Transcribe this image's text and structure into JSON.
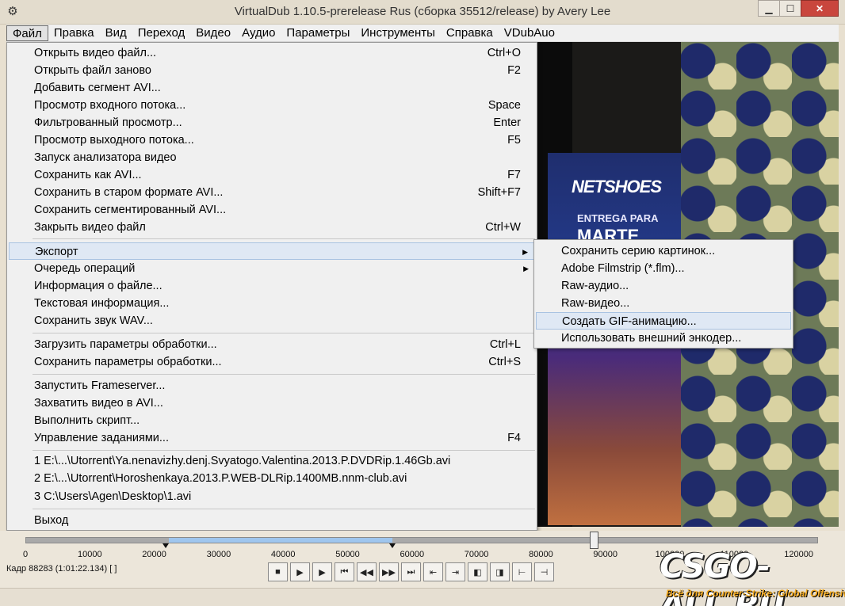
{
  "window": {
    "title": "VirtualDub 1.10.5-prerelease Rus (сборка 35512/release) by Avery Lee",
    "icon": "virtualdub-app-icon"
  },
  "menubar": [
    "Файл",
    "Правка",
    "Вид",
    "Переход",
    "Видео",
    "Аудио",
    "Параметры",
    "Инструменты",
    "Справка",
    "VDubAuo"
  ],
  "file_menu": {
    "items": [
      {
        "label": "Открыть видео файл...",
        "shortcut": "Ctrl+O"
      },
      {
        "label": "Открыть файл заново",
        "shortcut": "F2"
      },
      {
        "label": "Добавить сегмент AVI...",
        "shortcut": ""
      },
      {
        "label": "Просмотр входного потока...",
        "shortcut": "Space"
      },
      {
        "label": "Фильтрованный просмотр...",
        "shortcut": "Enter"
      },
      {
        "label": "Просмотр выходного потока...",
        "shortcut": "F5"
      },
      {
        "label": "Запуск анализатора видео",
        "shortcut": ""
      },
      {
        "label": "Сохранить как AVI...",
        "shortcut": "F7"
      },
      {
        "label": "Сохранить в старом формате AVI...",
        "shortcut": "Shift+F7"
      },
      {
        "label": "Сохранить сегментированный AVI...",
        "shortcut": ""
      },
      {
        "label": "Закрыть видео файл",
        "shortcut": "Ctrl+W"
      },
      {
        "label": "Экспорт",
        "shortcut": ""
      },
      {
        "label": "Очередь операций",
        "shortcut": ""
      },
      {
        "label": "Информация о файле...",
        "shortcut": ""
      },
      {
        "label": "Текстовая информация...",
        "shortcut": ""
      },
      {
        "label": "Сохранить звук WAV...",
        "shortcut": ""
      },
      {
        "label": "Загрузить параметры обработки...",
        "shortcut": "Ctrl+L"
      },
      {
        "label": "Сохранить параметры обработки...",
        "shortcut": "Ctrl+S"
      },
      {
        "label": "Запустить Frameserver...",
        "shortcut": ""
      },
      {
        "label": "Захватить видео в AVI...",
        "shortcut": ""
      },
      {
        "label": "Выполнить скрипт...",
        "shortcut": ""
      },
      {
        "label": "Управление заданиями...",
        "shortcut": "F4"
      },
      {
        "label": "1 E:\\...\\Utorrent\\Ya.nenavizhy.denj.Svyatogo.Valentina.2013.P.DVDRip.1.46Gb.avi",
        "shortcut": ""
      },
      {
        "label": "2 E:\\...\\Utorrent\\Horoshenkaya.2013.P.WEB-DLRip.1400MB.nnm-club.avi",
        "shortcut": ""
      },
      {
        "label": "3 C:\\Users\\Agen\\Desktop\\1.avi",
        "shortcut": ""
      },
      {
        "label": "Выход",
        "shortcut": ""
      }
    ]
  },
  "export_submenu": [
    "Сохранить серию картинок...",
    "Adobe Filmstrip (*.flm)...",
    "Raw-аудио...",
    "Raw-видео...",
    "Создать GIF-анимацию...",
    "Использовать внешний энкодер..."
  ],
  "video": {
    "brand": "NETSHOES",
    "line1": "ENTREGA PARA",
    "line2": "MARTE"
  },
  "timeline": {
    "ticks": [
      "0",
      "10000",
      "20000",
      "30000",
      "40000",
      "50000",
      "60000",
      "70000",
      "80000",
      "90000",
      "100000",
      "110000",
      "120000"
    ],
    "frame_info": "Кадр 88283 (1:01:22.134) [ ]",
    "current_frame": 88283,
    "total_frames": 123000,
    "selection_start": 22000,
    "selection_end": 57000
  },
  "watermark": {
    "main": "CSGO-ALL.RU",
    "sub": "Всё для Counter-Strike: Global Offensive"
  },
  "accent": {
    "menu_highlight": "#dfe8f4",
    "selection": "#9fc6ee",
    "close_button": "#c9463d"
  }
}
